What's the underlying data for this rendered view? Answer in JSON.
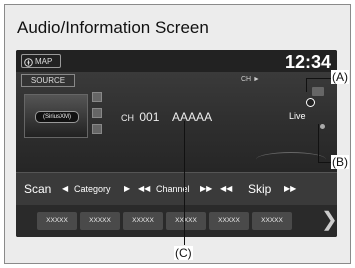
{
  "heading": "Audio/Information Screen",
  "topbar": {
    "map_label": "MAP",
    "time": "12:34"
  },
  "source_label": "SOURCE",
  "channel_indicator": "CH ►",
  "logo_text": "(SiriusXM)",
  "station": {
    "prefix": "CH",
    "number": "001",
    "name": "AAAAA"
  },
  "live_label": "Live",
  "controls": {
    "scan": "Scan",
    "category": "Category",
    "channel": "Channel",
    "skip": "Skip"
  },
  "presets": [
    "XXXXX",
    "XXXXX",
    "XXXXX",
    "XXXXX",
    "XXXXX",
    "XXXXX"
  ],
  "callouts": {
    "a": "(A)",
    "b": "(B)",
    "c": "(C)"
  }
}
